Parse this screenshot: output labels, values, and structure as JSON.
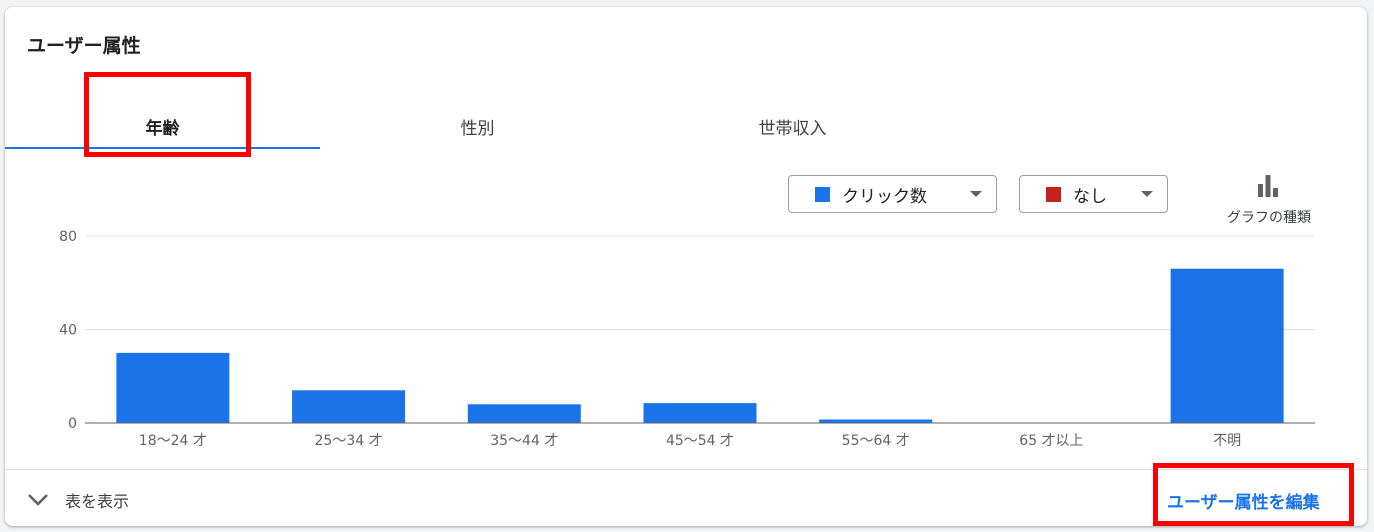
{
  "card": {
    "title": "ユーザー属性"
  },
  "tabs": [
    {
      "label": "年齢",
      "active": true
    },
    {
      "label": "性別",
      "active": false
    },
    {
      "label": "世帯収入",
      "active": false
    }
  ],
  "metric_selectors": [
    {
      "label": "クリック数",
      "color": "#1a73e8"
    },
    {
      "label": "なし",
      "color": "#c5221f"
    }
  ],
  "chart_type_button": {
    "label": "グラフの種類",
    "icon": "bar-chart-icon"
  },
  "chart_data": {
    "type": "bar",
    "categories": [
      "18〜24 才",
      "25〜34 才",
      "35〜44 才",
      "45〜54 才",
      "55〜64 才",
      "65 才以上",
      "不明"
    ],
    "series": [
      {
        "values": [
          30,
          14,
          8,
          8.5,
          1.5,
          0,
          66
        ]
      }
    ],
    "y_ticks": [
      0,
      40,
      80
    ],
    "ylim": [
      0,
      80
    ],
    "bar_color": "#1a73e8",
    "grid": true
  },
  "footer": {
    "show_table_label": "表を表示",
    "edit_link_label": "ユーザー属性を編集"
  },
  "colors": {
    "accent": "#1a73e8",
    "highlight": "#ff0000"
  }
}
